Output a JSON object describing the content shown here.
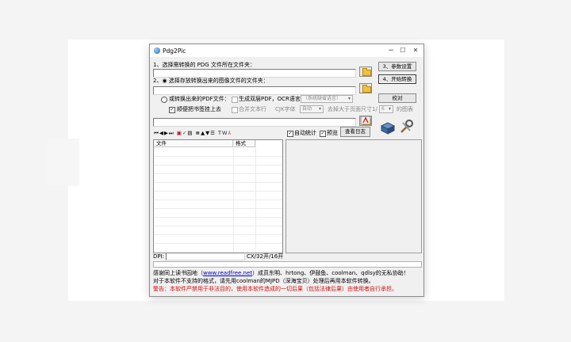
{
  "window": {
    "title": "Pdg2Pic",
    "controls": {
      "minimize": "−",
      "maximize": "☐",
      "close": "✕"
    }
  },
  "step1": {
    "label": "1、选择需转换的 PDG 文件所在文件夹：",
    "path": ""
  },
  "step2": {
    "label": "2、◉ 选择存放转换出来的图像文件的文件夹：",
    "path": ""
  },
  "buttons": {
    "params": "3、参数设置",
    "start": "4、开始转换",
    "proofread": "校对",
    "view_log": "查看日志"
  },
  "pdf_options": {
    "or_pdf_label": "或转换出来的PDF文件：",
    "double_layer_pdf": "生成双层PDF，OCR语言",
    "ocr_lang": "（系统缺省语言）",
    "bookmark_label": "顺便把书签挂上去",
    "bookmark_checked": true,
    "merge_text": "合并文本行",
    "cjk_font": "CJK字体",
    "cjk_value": "自动",
    "remove_big": "去掉大于页面尺寸1/",
    "ratio_value": "6",
    "remove_big_suffix": "的图表"
  },
  "toolbar_right": {
    "auto_stats": "自动统计",
    "auto_stats_checked": true,
    "preview": "预览",
    "preview_checked": true
  },
  "toolbar_icons": [
    "first-icon",
    "prev-icon",
    "next-icon",
    "last-icon",
    "copy-icon",
    "check-icon",
    "page-icon",
    "align-icon",
    "up-icon",
    "down-icon",
    "sort-icon",
    "text-icon",
    "word-icon",
    "pdf-icon"
  ],
  "file_list": {
    "columns": [
      "文件",
      "格式"
    ],
    "rows": []
  },
  "status": {
    "dpi_label": "DPI:",
    "pages": "CX/32开/16开"
  },
  "footer": {
    "line1_a": "感谢同上读书园地（",
    "line1_link": "www.readfree.net",
    "line1_b": "）成员东明、hrtong、伊鼓鱼、coolman、qdlsy的无私协助！",
    "line2": "对于本软件不支持的格式，请先用coolman的MJPD（深海宝贝）处理后再用本软件转换。",
    "line3": "警告：本软件严禁用于非法目的，使用本软件造成的一切后果（包括法律后果）由使用者自行承担。"
  },
  "colors": {
    "warning": "#d21010",
    "link": "#0000cc"
  }
}
